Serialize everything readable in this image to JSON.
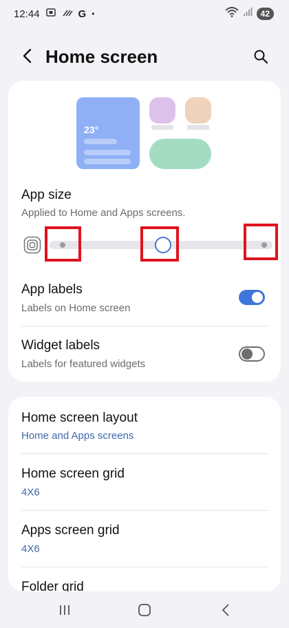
{
  "status_bar": {
    "time": "12:44",
    "g_label": "G",
    "dot": "•",
    "battery": "42"
  },
  "header": {
    "title": "Home screen"
  },
  "preview": {
    "temperature": "23°"
  },
  "app_size": {
    "title": "App size",
    "subtitle": "Applied to Home and Apps screens.",
    "level_index": 1,
    "level_count": 3
  },
  "app_labels": {
    "title": "App labels",
    "subtitle": "Labels on Home screen",
    "enabled": true
  },
  "widget_labels": {
    "title": "Widget labels",
    "subtitle": "Labels for featured widgets",
    "enabled": false
  },
  "home_screen_layout": {
    "title": "Home screen layout",
    "value": "Home and Apps screens"
  },
  "home_screen_grid": {
    "title": "Home screen grid",
    "value": "4X6"
  },
  "apps_screen_grid": {
    "title": "Apps screen grid",
    "value": "4X6"
  },
  "folder_grid": {
    "title": "Folder grid"
  },
  "colors": {
    "accent": "#3e75db",
    "link_blue": "#3e68a8",
    "highlight_red": "#e0121d"
  }
}
